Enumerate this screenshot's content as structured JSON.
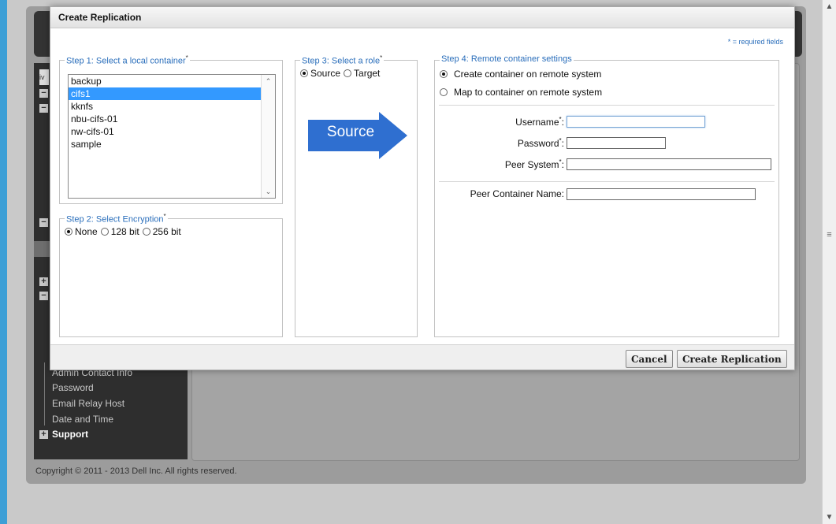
{
  "dialog": {
    "title": "Create Replication",
    "required_note": "* = required fields",
    "required_marker": "*"
  },
  "step1": {
    "legend": "Step 1: Select a local container",
    "containers": [
      "backup",
      "cifs1",
      "kknfs",
      "nbu-cifs-01",
      "nw-cifs-01",
      "sample"
    ],
    "selected_index": 1
  },
  "step2": {
    "legend": "Step 2: Select Encryption",
    "options": [
      "None",
      "128 bit",
      "256 bit"
    ],
    "selected": "None"
  },
  "step3": {
    "legend": "Step 3: Select a role",
    "options": [
      "Source",
      "Target"
    ],
    "selected": "Source",
    "arrow_label": "Source",
    "arrow_color": "#2f6fd0"
  },
  "step4": {
    "legend": "Step 4: Remote container settings",
    "options": [
      "Create container on remote system",
      "Map to container on remote system"
    ],
    "selected": "Create container on remote system",
    "username_label": "Username",
    "password_label": "Password",
    "peer_system_label": "Peer System",
    "peer_container_label": "Peer Container Name:",
    "username_value": "",
    "password_value": "",
    "peer_system_value": "",
    "peer_container_value": ""
  },
  "buttons": {
    "cancel": "Cancel",
    "create": "Create Replication"
  },
  "background": {
    "nav_items": [
      "Admin Contact Info",
      "Password",
      "Email Relay Host",
      "Date and Time"
    ],
    "nav_support": "Support",
    "copyright": "Copyright © 2011 - 2013 Dell Inc. All rights reserved."
  },
  "colors": {
    "legend_text": "#2a6ebb",
    "selection": "#3399ff",
    "window_accent": "#3d9fd6"
  }
}
